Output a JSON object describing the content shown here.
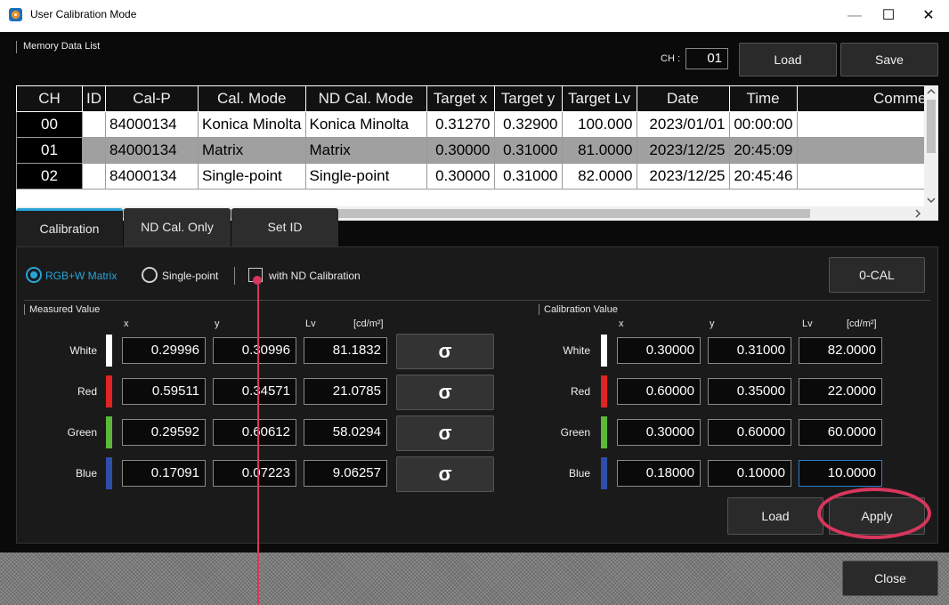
{
  "window": {
    "title": "User Calibration Mode",
    "minimize": "—",
    "maximize": "☐",
    "close": "✕"
  },
  "memory": {
    "section_label": "Memory Data List",
    "ch_label": "CH :",
    "ch_value": "01",
    "load_label": "Load",
    "save_label": "Save"
  },
  "table": {
    "headers": [
      "CH",
      "ID",
      "Cal-P",
      "Cal. Mode",
      "ND Cal. Mode",
      "Target x",
      "Target y",
      "Target Lv",
      "Date",
      "Time",
      "Comme"
    ],
    "rows": [
      [
        "00",
        "",
        "84000134",
        "Konica Minolta",
        "Konica Minolta",
        "0.31270",
        "0.32900",
        "100.000",
        "2023/01/01",
        "00:00:00",
        ""
      ],
      [
        "01",
        "",
        "84000134",
        "Matrix",
        "Matrix",
        "0.30000",
        "0.31000",
        "81.0000",
        "2023/12/25",
        "20:45:09",
        ""
      ],
      [
        "02",
        "",
        "84000134",
        "Single-point",
        "Single-point",
        "0.30000",
        "0.31000",
        "82.0000",
        "2023/12/25",
        "20:45:46",
        ""
      ]
    ]
  },
  "tabs": [
    "Calibration",
    "ND Cal. Only",
    "Set ID"
  ],
  "options": {
    "rgbw_label": "RGB+W Matrix",
    "single_label": "Single-point",
    "nd_label": "with ND Calibration",
    "zero_cal_label": "0-CAL"
  },
  "measured": {
    "section_label": "Measured Value",
    "col_x": "x",
    "col_y": "y",
    "col_lv": "Lv",
    "unit": "[cd/m²]",
    "button_glyph": "σ",
    "rows": [
      {
        "name": "White",
        "color": "#ffffff",
        "x": "0.29996",
        "y": "0.30996",
        "lv": "81.1832"
      },
      {
        "name": "Red",
        "color": "#e02424",
        "x": "0.59511",
        "y": "0.34571",
        "lv": "21.0785"
      },
      {
        "name": "Green",
        "color": "#5cb83a",
        "x": "0.29592",
        "y": "0.60612",
        "lv": "58.0294"
      },
      {
        "name": "Blue",
        "color": "#2d4fa8",
        "x": "0.17091",
        "y": "0.07223",
        "lv": "9.06257"
      }
    ]
  },
  "calibration": {
    "section_label": "Calibration Value",
    "col_x": "x",
    "col_y": "y",
    "col_lv": "Lv",
    "unit": "[cd/m²]",
    "rows": [
      {
        "name": "White",
        "color": "#ffffff",
        "x": "0.30000",
        "y": "0.31000",
        "lv": "82.0000"
      },
      {
        "name": "Red",
        "color": "#e02424",
        "x": "0.60000",
        "y": "0.35000",
        "lv": "22.0000"
      },
      {
        "name": "Green",
        "color": "#5cb83a",
        "x": "0.30000",
        "y": "0.60000",
        "lv": "60.0000"
      },
      {
        "name": "Blue",
        "color": "#2d4fa8",
        "x": "0.18000",
        "y": "0.10000",
        "lv": "10.0000"
      }
    ],
    "load_label": "Load",
    "apply_label": "Apply"
  },
  "footer": {
    "close_label": "Close"
  },
  "colors": {
    "accent": "#2aa4d6",
    "annotation": "#d8365c"
  }
}
